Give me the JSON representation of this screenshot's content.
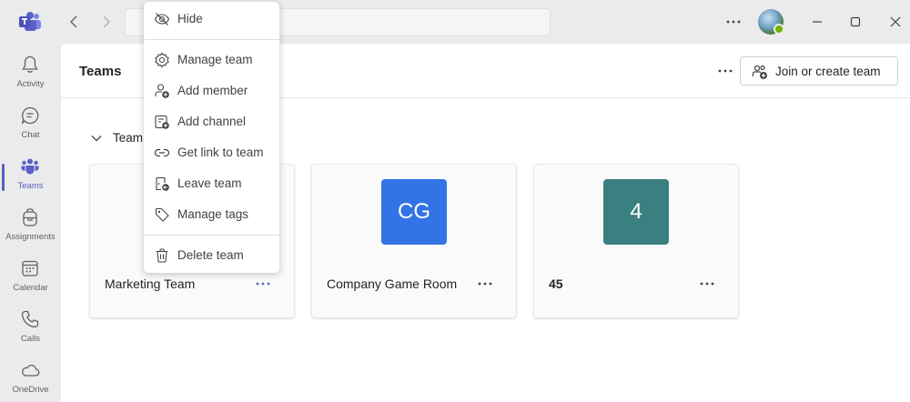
{
  "app": {
    "logo_icon": "microsoft-teams-logo",
    "brand_color": "#5b5fc7"
  },
  "titlebar": {
    "search_placeholder": "",
    "icons": [
      "back-arrow-icon",
      "forward-arrow-icon",
      "more-icon",
      "minimize-icon",
      "maximize-icon",
      "close-icon"
    ]
  },
  "rail": {
    "items": [
      {
        "label": "Activity",
        "icon": "bell-icon"
      },
      {
        "label": "Chat",
        "icon": "chat-icon"
      },
      {
        "label": "Teams",
        "icon": "teams-icon",
        "active": true
      },
      {
        "label": "Assignments",
        "icon": "backpack-icon"
      },
      {
        "label": "Calendar",
        "icon": "calendar-icon"
      },
      {
        "label": "Calls",
        "icon": "phone-icon"
      },
      {
        "label": "OneDrive",
        "icon": "cloud-icon"
      }
    ]
  },
  "header": {
    "title": "Teams",
    "join_button": "Join or create team"
  },
  "section": {
    "label": "Team"
  },
  "cards": [
    {
      "name": "Marketing Team",
      "tile_text": "",
      "tile_color": ""
    },
    {
      "name": "Company Game Room",
      "tile_text": "CG",
      "tile_color": "#3373e6"
    },
    {
      "name": "45",
      "tile_text": "4",
      "tile_color": "#3b8080"
    }
  ],
  "menu": {
    "items": [
      {
        "label": "Hide",
        "icon": "eye-off-icon"
      },
      {
        "label": "Manage team",
        "icon": "gear-icon"
      },
      {
        "label": "Add member",
        "icon": "add-person-icon"
      },
      {
        "label": "Add channel",
        "icon": "add-channel-icon"
      },
      {
        "label": "Get link to team",
        "icon": "link-icon"
      },
      {
        "label": "Leave team",
        "icon": "leave-icon"
      },
      {
        "label": "Manage tags",
        "icon": "tag-icon"
      },
      {
        "label": "Delete team",
        "icon": "trash-icon"
      }
    ]
  }
}
